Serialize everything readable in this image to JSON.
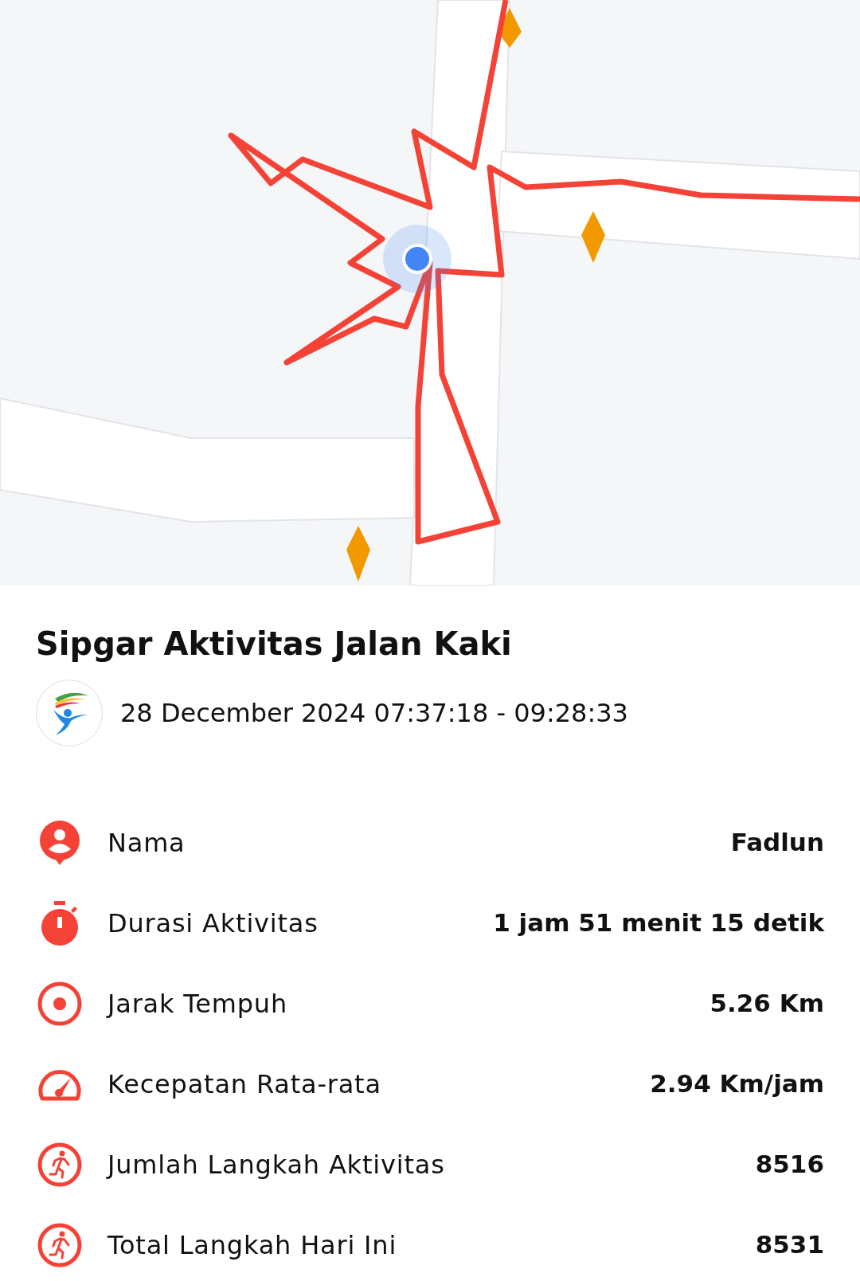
{
  "activity": {
    "title": "Sipgar Aktivitas Jalan Kaki",
    "datetime": "28 December 2024 07:37:18 - 09:28:33"
  },
  "stats": [
    {
      "kind": "person",
      "label": "Nama",
      "value": "Fadlun"
    },
    {
      "kind": "timer",
      "label": "Durasi Aktivitas",
      "value": "1 jam 51 menit 15 detik"
    },
    {
      "kind": "target",
      "label": "Jarak Tempuh",
      "value": "5.26 Km"
    },
    {
      "kind": "speed",
      "label": "Kecepatan Rata-rata",
      "value": "2.94 Km/jam"
    },
    {
      "kind": "steps",
      "label": "Jumlah Langkah Aktivitas",
      "value": "8516"
    },
    {
      "kind": "steps",
      "label": "Total Langkah Hari Ini",
      "value": "8531"
    }
  ]
}
